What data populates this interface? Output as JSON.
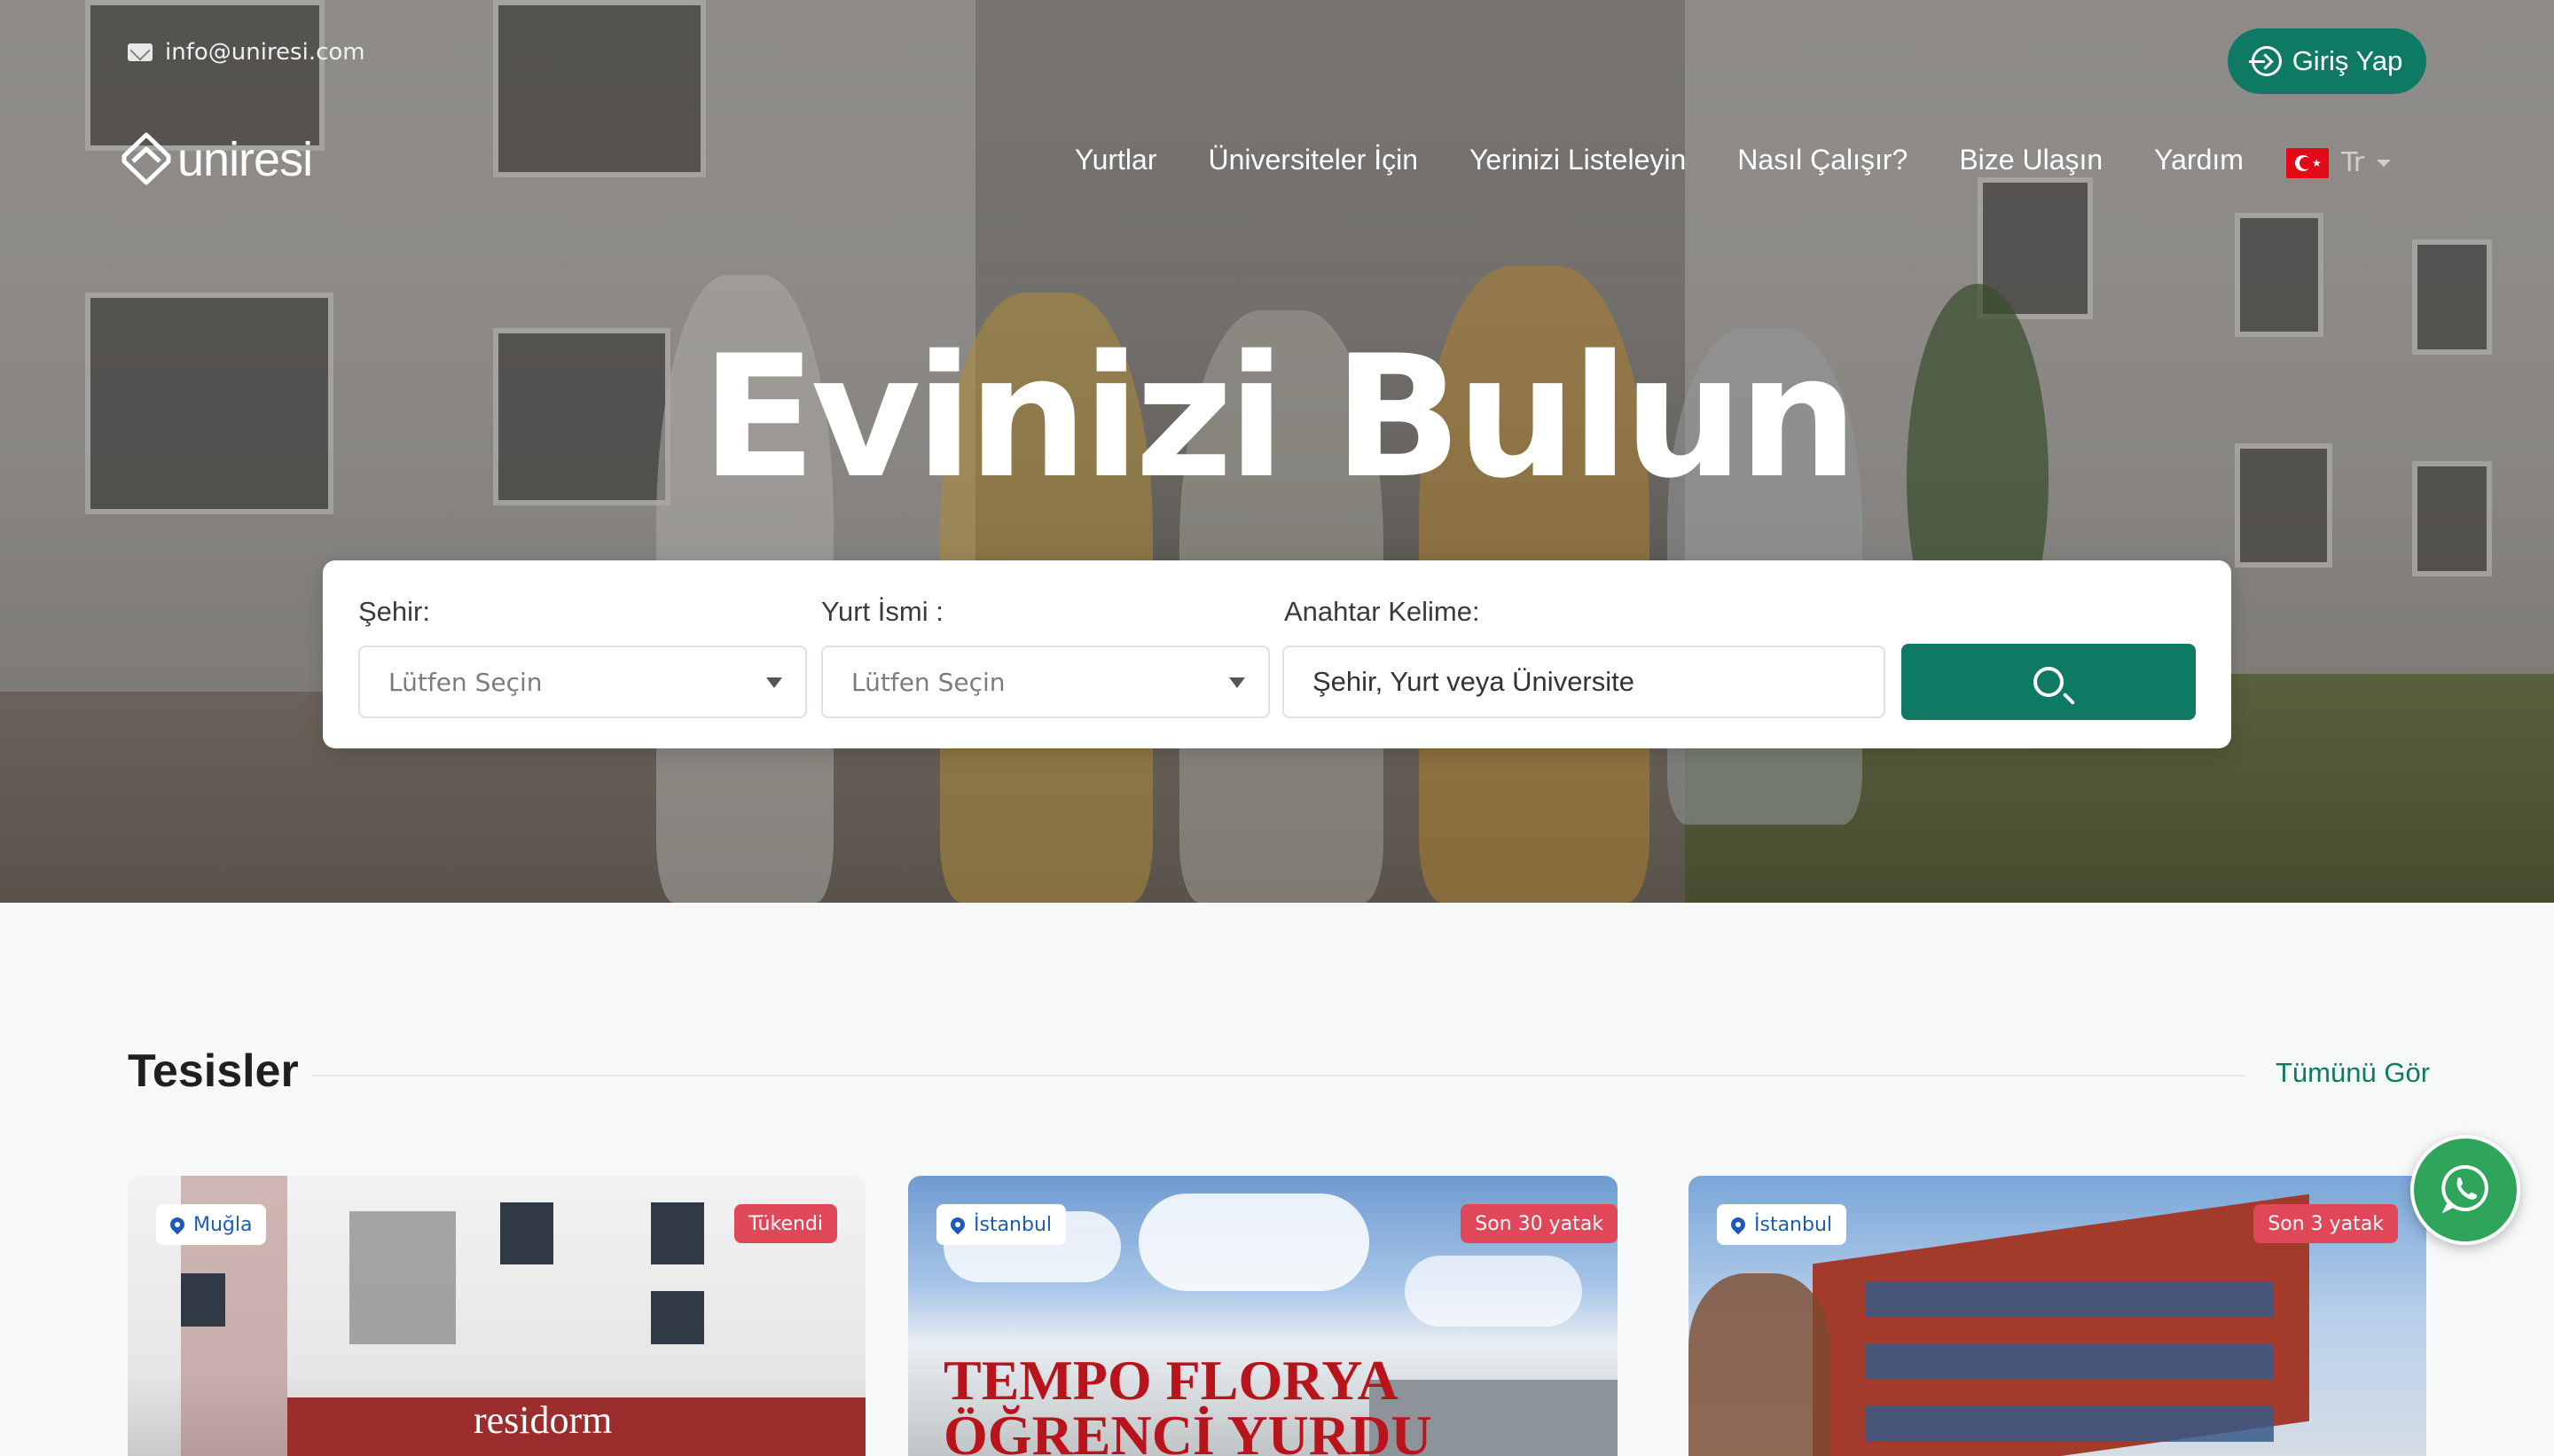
{
  "topbar": {
    "email": "info@uniresi.com",
    "login_label": "Giriş Yap"
  },
  "brand": {
    "name": "uniresi"
  },
  "nav": {
    "items": [
      "Yurtlar",
      "Üniversiteler İçin",
      "Yerinizi Listeleyin",
      "Nasıl Çalışır?",
      "Bize Ulaşın",
      "Yardım"
    ],
    "language": "Tr"
  },
  "hero": {
    "headline": "Evinizi Bulun"
  },
  "search": {
    "city_label": "Şehir:",
    "city_value": "Lütfen Seçin",
    "dorm_label": "Yurt İsmi :",
    "dorm_value": "Lütfen Seçin",
    "keyword_label": "Anahtar Kelime:",
    "keyword_placeholder": "Şehir, Yurt veya Üniversite"
  },
  "section": {
    "title": "Tesisler",
    "see_all": "Tümünü Gör"
  },
  "cards": [
    {
      "city": "Muğla",
      "status": "Tükendi"
    },
    {
      "city": "İstanbul",
      "status": "Son 30 yatak"
    },
    {
      "city": "İstanbul",
      "status": "Son 3 yatak"
    }
  ],
  "colors": {
    "primary": "#0e7a64",
    "status_badge": "#e0485a",
    "location_text": "#1e5bb4",
    "whatsapp": "#2ea55a"
  },
  "icons": [
    "mail-icon",
    "login-icon",
    "logo-mark-icon",
    "flag-tr-icon",
    "search-icon",
    "location-pin-icon",
    "whatsapp-icon"
  ],
  "card_images": [
    "residorm",
    "TEMPO FLORYA ÖĞRENCİ YURDU"
  ]
}
